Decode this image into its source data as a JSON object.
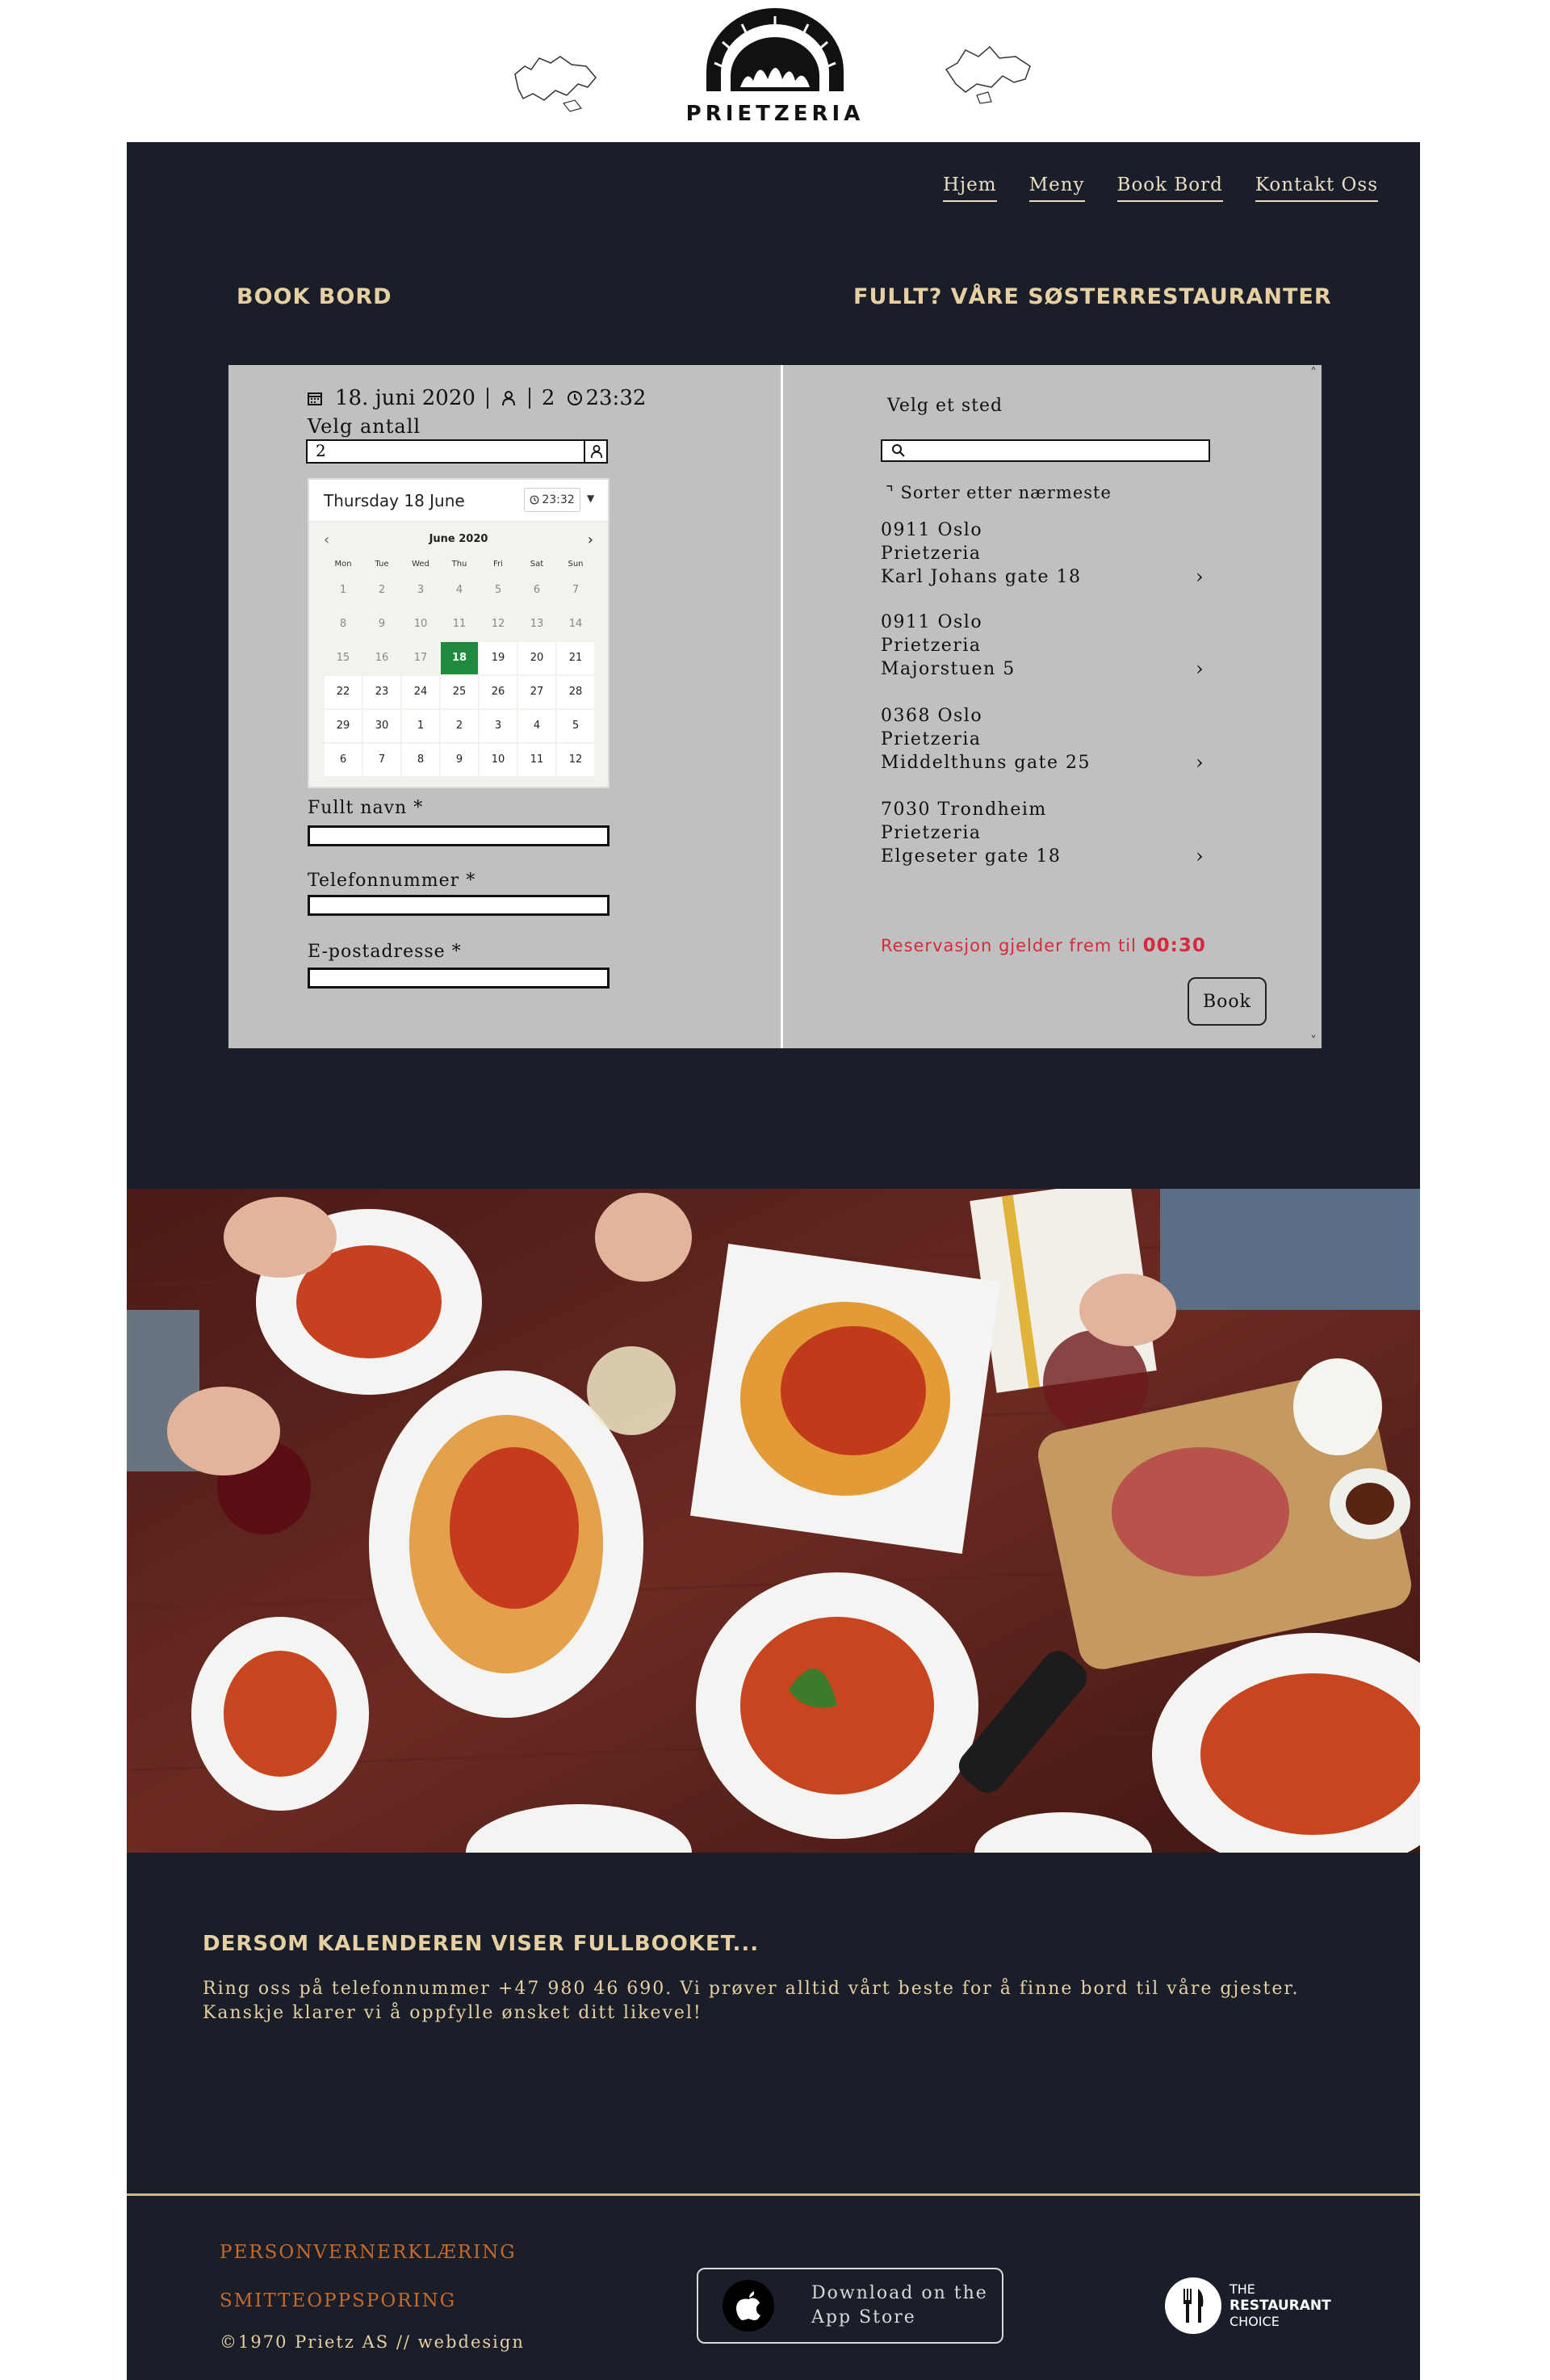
{
  "brand": {
    "name": "PRIETZERIA"
  },
  "nav": {
    "items": [
      "Hjem",
      "Meny",
      "Book Bord",
      "Kontakt Oss"
    ]
  },
  "headings": {
    "book": "BOOK BORD",
    "sister": "FULLT? VÅRE SØSTERRESTAURANTER"
  },
  "booking": {
    "summary_date": "18. juni 2020",
    "summary_people": "2",
    "summary_time": "23:32",
    "antall_label": "Velg antall",
    "antall_value": "2",
    "calendar": {
      "selected_label": "Thursday 18 June",
      "time": "23:32",
      "month": "June 2020",
      "weekdays": [
        "Mon",
        "Tue",
        "Wed",
        "Thu",
        "Fri",
        "Sat",
        "Sun"
      ],
      "days": [
        "1",
        "2",
        "3",
        "4",
        "5",
        "6",
        "7",
        "8",
        "9",
        "10",
        "11",
        "12",
        "13",
        "14",
        "15",
        "16",
        "17",
        "18",
        "19",
        "20",
        "21",
        "22",
        "23",
        "24",
        "25",
        "26",
        "27",
        "28",
        "29",
        "30",
        "1",
        "2",
        "3",
        "4",
        "5",
        "6",
        "7",
        "8",
        "9",
        "10",
        "11",
        "12"
      ],
      "selected_day": "18"
    },
    "fields": {
      "name": "Fullt navn *",
      "phone": "Telefonnummer *",
      "email": "E-postadresse *"
    }
  },
  "sister": {
    "label": "Velg et sted",
    "sort_label": "Sorter etter nærmeste",
    "locations": [
      {
        "city": "0911 Oslo",
        "name": "Prietzeria",
        "address": "Karl Johans gate 18"
      },
      {
        "city": "0911 Oslo",
        "name": "Prietzeria",
        "address": "Majorstuen 5"
      },
      {
        "city": "0368 Oslo",
        "name": "Prietzeria",
        "address": "Middelthuns gate 25"
      },
      {
        "city": "7030 Trondheim",
        "name": "Prietzeria",
        "address": "Elgeseter gate 18"
      }
    ],
    "note_prefix": "Reservasjon gjelder frem til",
    "note_time": "00:30",
    "book_label": "Book"
  },
  "fullbooked": {
    "heading": "DERSOM KALENDEREN VISER FULLBOOKET...",
    "text": "Ring oss på telefonnummer +47 980 46 690. Vi prøver alltid vårt beste for å finne bord til våre gjester. Kanskje klarer vi å oppfylle ønsket ditt likevel!"
  },
  "footer": {
    "privacy": "PERSONVERNERKLÆRING",
    "tracing": "SMITTEOPPSPORING",
    "copyright": "©1970 Prietz AS // webdesign",
    "appstore_line1": "Download on the",
    "appstore_line2": "App Store",
    "award_line1": "THE",
    "award_line2": "RESTAURANT",
    "award_line3": "CHOICE"
  },
  "colors": {
    "panel": "#1a1e28",
    "gold": "#e6cfa2",
    "accent_red": "#d52a3b",
    "orange": "#c76a2b",
    "cal_selected": "#1e8c3c"
  }
}
